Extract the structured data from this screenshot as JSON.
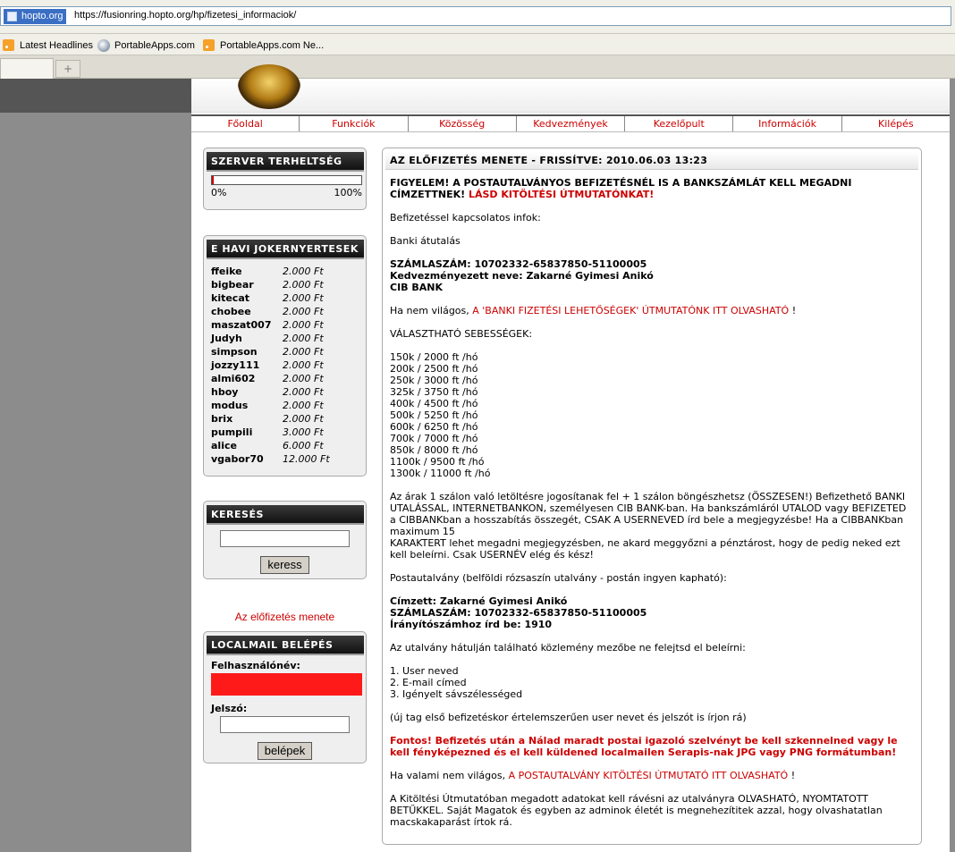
{
  "browser": {
    "site_badge": "hopto.org",
    "url": "https://fusionring.hopto.org/hp/fizetesi_informaciok/",
    "bookmarks": [
      "Latest Headlines",
      "PortableApps.com",
      "PortableApps.com Ne..."
    ],
    "newtab_icon": "+"
  },
  "nav": [
    "Főoldal",
    "Funkciók",
    "Közösség",
    "Kedvezmények",
    "Kezelőpult",
    "Információk",
    "Kilépés"
  ],
  "server_load": {
    "title": "SZERVER TERHELTSÉG",
    "min_label": "0%",
    "max_label": "100%",
    "level_fraction": 0.01
  },
  "jokers": {
    "title": "E HAVI JOKERNYERTESEK",
    "rows": [
      {
        "name": "ffeike",
        "amount": "2.000 Ft"
      },
      {
        "name": "bigbear",
        "amount": "2.000 Ft"
      },
      {
        "name": "kitecat",
        "amount": "2.000 Ft"
      },
      {
        "name": "chobee",
        "amount": "2.000 Ft"
      },
      {
        "name": "maszat007",
        "amount": "2.000 Ft"
      },
      {
        "name": "Judyh",
        "amount": "2.000 Ft"
      },
      {
        "name": "simpson",
        "amount": "2.000 Ft"
      },
      {
        "name": "jozzy111",
        "amount": "2.000 Ft"
      },
      {
        "name": "almi602",
        "amount": "2.000 Ft"
      },
      {
        "name": "hboy",
        "amount": "2.000 Ft"
      },
      {
        "name": "modus",
        "amount": "2.000 Ft"
      },
      {
        "name": "brix",
        "amount": "2.000 Ft"
      },
      {
        "name": "pumpili",
        "amount": "3.000 Ft"
      },
      {
        "name": "alice",
        "amount": "6.000 Ft"
      },
      {
        "name": "vgabor70",
        "amount": "12.000 Ft"
      }
    ]
  },
  "search": {
    "title": "KERESÉS",
    "value": "",
    "button": "keress"
  },
  "side_link": "Az előfizetés menete",
  "localmail": {
    "title": "LOCALMAIL BELÉPÉS",
    "user_label": "Felhasználónév:",
    "pass_label": "Jelszó:",
    "button": "belépek"
  },
  "main": {
    "title": "AZ ELŐFIZETÉS MENETE - FRISSÍTVE: 2010.06.03 13:23",
    "warning": "FIGYELEM! A POSTAUTALVÁNYOS BEFIZETÉSNÉL IS A BANKSZÁMLÁT KELL MEGADNI CÍMZETTNEK!",
    "warning_link": "LÁSD KITÖLTÉSI ÚTMUTATÓNKAT!",
    "intro": "Befizetéssel kapcsolatos infok:",
    "bank_heading": "Banki átutalás",
    "bank_lines": [
      "SZÁMLASZÁM: 10702332-65837850-51100005",
      "Kedvezményezett neve: Zakarné Gyimesi Anikó",
      "CIB BANK"
    ],
    "bank_help_prefix": "Ha nem világos,",
    "bank_help_link": "A 'BANKI FIZETÉSI LEHETŐSÉGEK' ÚTMUTATÓNK ITT OLVASHATÓ",
    "bank_help_suffix": "!",
    "speeds_heading": "VÁLASZTHATÓ SEBESSÉGEK:",
    "speeds": [
      "150k / 2000 ft /hó",
      "200k / 2500 ft /hó",
      "250k / 3000 ft /hó",
      "325k / 3750 ft /hó",
      "400k / 4500 ft /hó",
      "500k / 5250 ft /hó",
      "600k / 6250 ft /hó",
      "700k / 7000 ft /hó",
      "850k / 8000 ft /hó",
      "1100k / 9500 ft /hó",
      "1300k / 11000 ft /hó"
    ],
    "price_note_1": "Az árak 1 szálon való letöltésre jogosítanak fel + 1 szálon böngészhetsz (ÖSSZESEN!) Befizethető BANKI UTALÁSSAL, INTERNETBANKON, személyesen CIB BANK-ban. Ha bankszámláról UTALOD vagy BEFIZETED a CIBBANKban a hosszabítás összegét, CSAK A USERNEVED írd bele a megjegyzésbe! Ha a CIBBANKban maximum 15",
    "price_note_2": "KARAKTERT lehet megadni megjegyzésben, ne akard meggyőzni a pénztárost, hogy de pedig neked ezt kell beleírni. Csak USERNÉV elég és kész!",
    "postal_heading": "Postautalvány (belföldi rózsaszín utalvány - postán ingyen kapható):",
    "postal_lines": [
      "Címzett: Zakarné Gyimesi Anikó",
      "SZÁMLASZÁM: 10702332-65837850-51100005",
      "Írányítószámhoz írd be: 1910"
    ],
    "notice_text": "Az utalvány hátulján található közlemény mezőbe ne felejtsd el beleírni:",
    "notice_items": [
      "1. User neved",
      "2. E-mail címed",
      "3. Igényelt sávszélességed"
    ],
    "first_pay_note": "(új tag első befizetéskor értelemszerűen user nevet és jelszót is írjon rá)",
    "important": "Fontos! Befizetés után a Nálad maradt postai igazoló szelvényt be kell szkennelned vagy le kell fényképezned és el kell küldened localmailen Serapis-nak JPG vagy PNG formátumban!",
    "postal_help_prefix": "Ha valami nem világos,",
    "postal_help_link": "A POSTAUTALVÁNY KITÖLTÉSI ÚTMUTATÓ ITT OLVASHATÓ",
    "postal_help_suffix": "!",
    "final_note": "A Kitöltési Útmutatóban megadott adatokat kell rávésni az utalványra OLVASHATÓ, NYOMTATOTT BETŰKKEL. Saját Magatok és egyben az adminok életét is megnehezítitek azzal, hogy olvashatatlan macskakaparást írtok rá."
  }
}
